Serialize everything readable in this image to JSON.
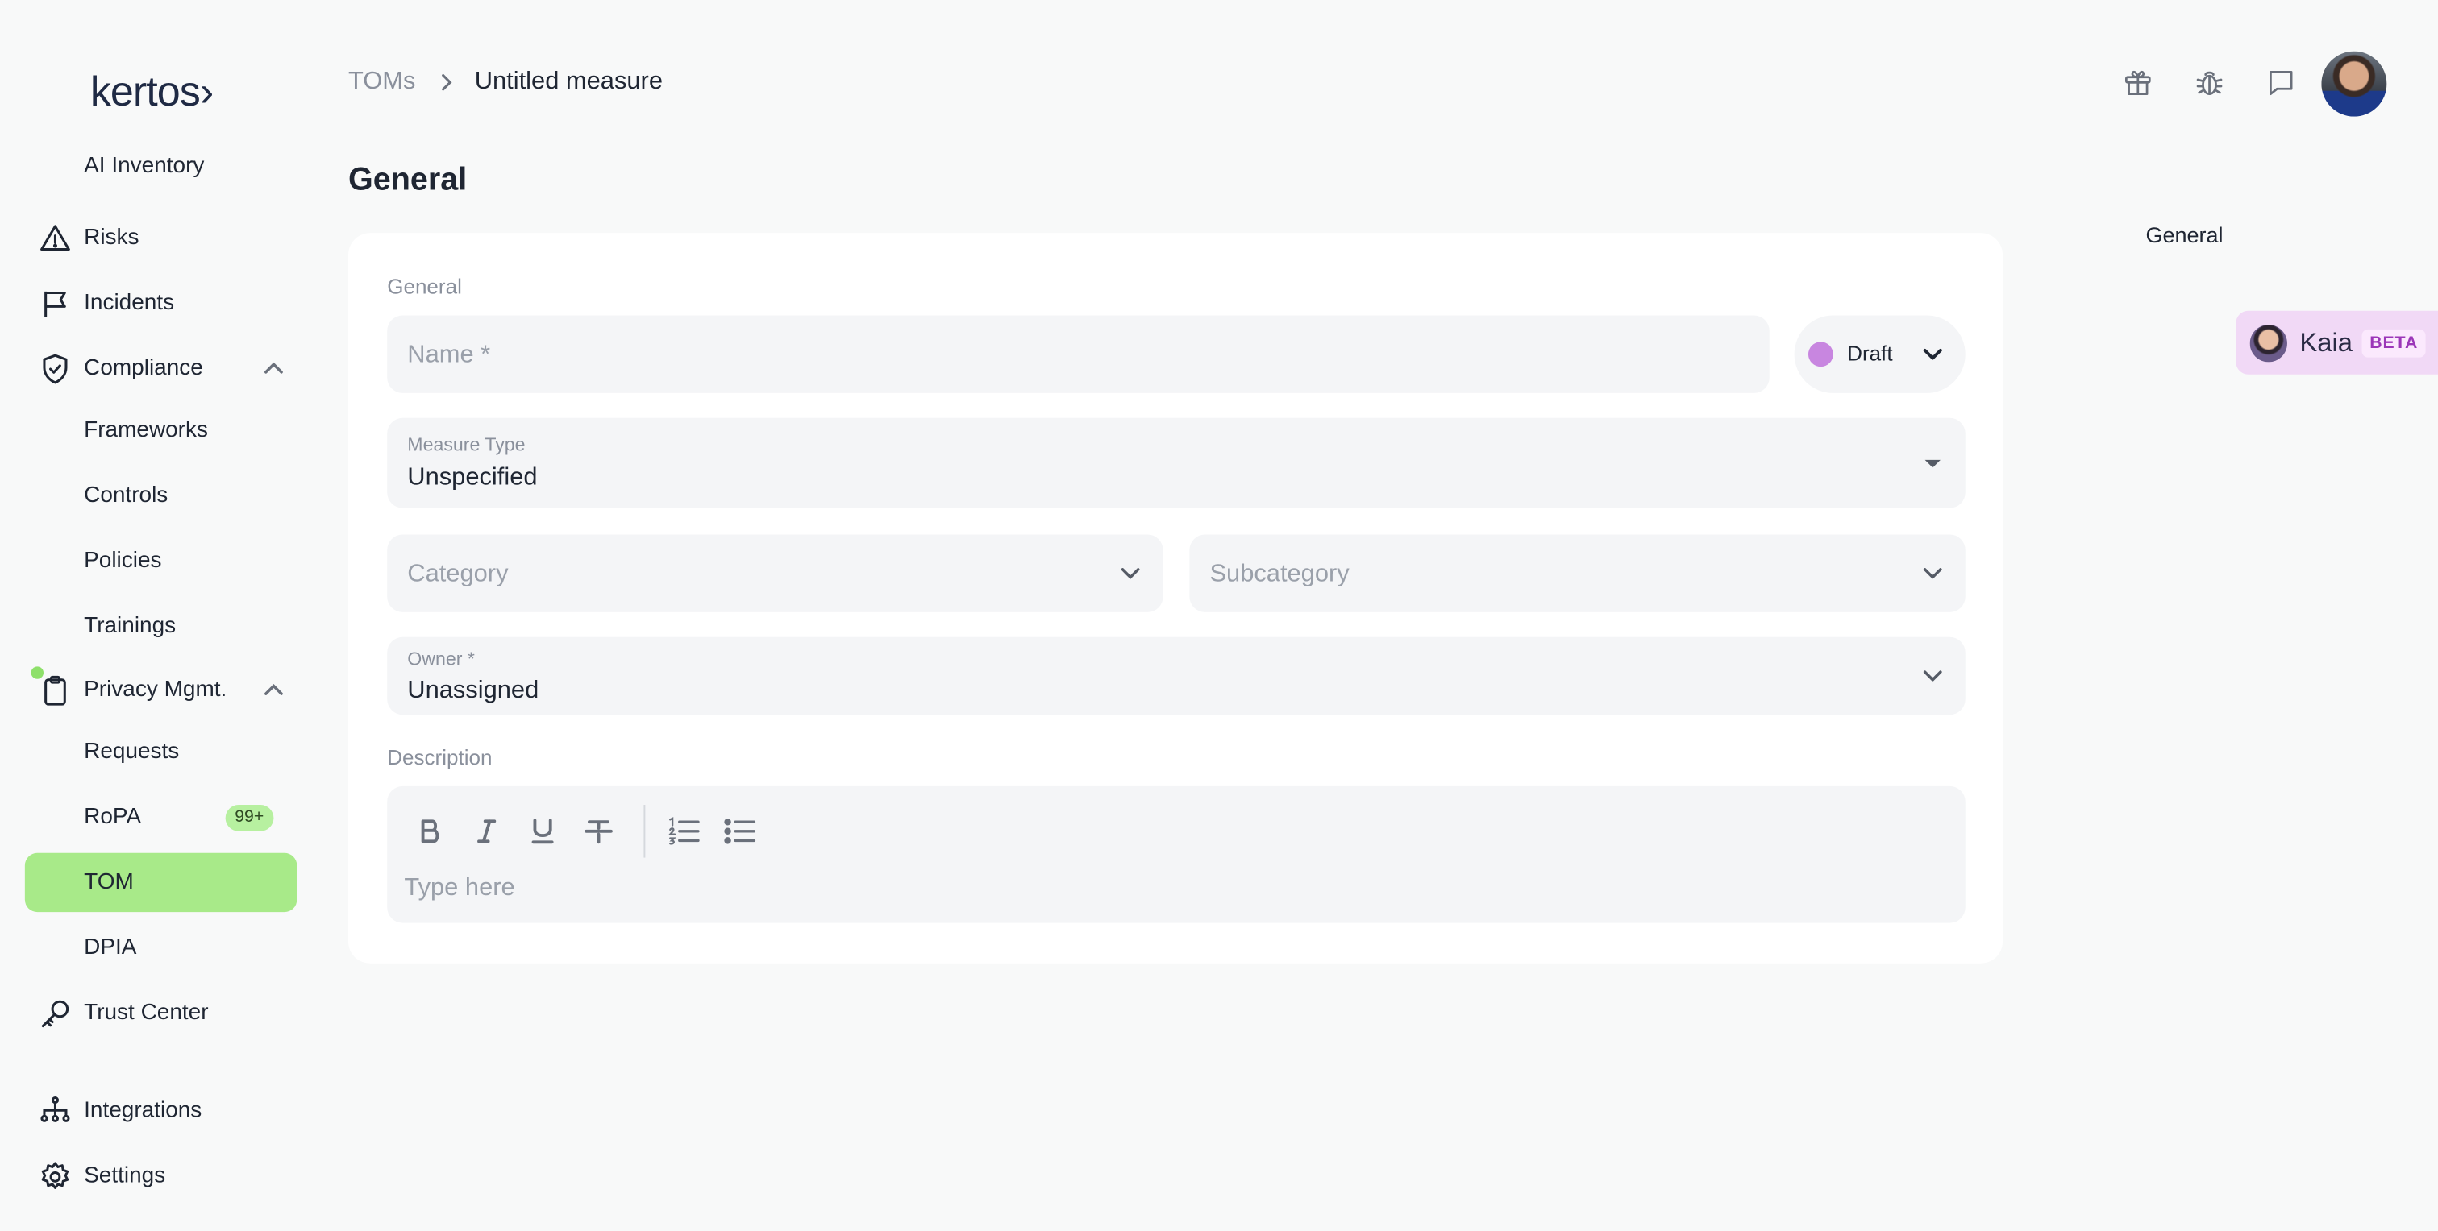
{
  "app": {
    "logo": "kertos›"
  },
  "sidebar": {
    "items": [
      {
        "label": "AI Inventory",
        "icon": "none"
      },
      {
        "label": "Risks",
        "icon": "warning-icon"
      },
      {
        "label": "Incidents",
        "icon": "flag-icon"
      },
      {
        "label": "Compliance",
        "icon": "shield-check-icon",
        "expanded": true
      },
      {
        "label": "Frameworks"
      },
      {
        "label": "Controls"
      },
      {
        "label": "Policies"
      },
      {
        "label": "Trainings"
      },
      {
        "label": "Privacy Mgmt.",
        "icon": "clipboard-icon",
        "expanded": true
      },
      {
        "label": "Requests"
      },
      {
        "label": "RoPA",
        "badge": "99+"
      },
      {
        "label": "TOM",
        "active": true
      },
      {
        "label": "DPIA"
      },
      {
        "label": "Trust Center",
        "icon": "key-icon"
      },
      {
        "label": "Integrations",
        "icon": "hierarchy-icon"
      },
      {
        "label": "Settings",
        "icon": "gear-icon"
      }
    ]
  },
  "header": {
    "breadcrumb_parent": "TOMs",
    "breadcrumb_current": "Untitled measure",
    "icons": [
      "gift-icon",
      "bug-icon",
      "chat-icon"
    ]
  },
  "page": {
    "title": "General",
    "toc_general": "General"
  },
  "kaia": {
    "name": "Kaia",
    "badge": "BETA"
  },
  "form": {
    "section_label": "General",
    "name_placeholder": "Name *",
    "status": {
      "label": "Draft",
      "color": "#c886e0"
    },
    "measure_type": {
      "label": "Measure Type",
      "value": "Unspecified"
    },
    "category_placeholder": "Category",
    "subcategory_placeholder": "Subcategory",
    "owner": {
      "label": "Owner *",
      "value": "Unassigned"
    },
    "description_label": "Description",
    "description_placeholder": "Type here",
    "toolbar": [
      "bold-icon",
      "italic-icon",
      "underline-icon",
      "strikethrough-icon",
      "ordered-list-icon",
      "bullet-list-icon"
    ]
  },
  "colors": {
    "accent_green": "#a8ea89",
    "background": "#f8f9f9",
    "field_bg": "#f4f5f7"
  }
}
